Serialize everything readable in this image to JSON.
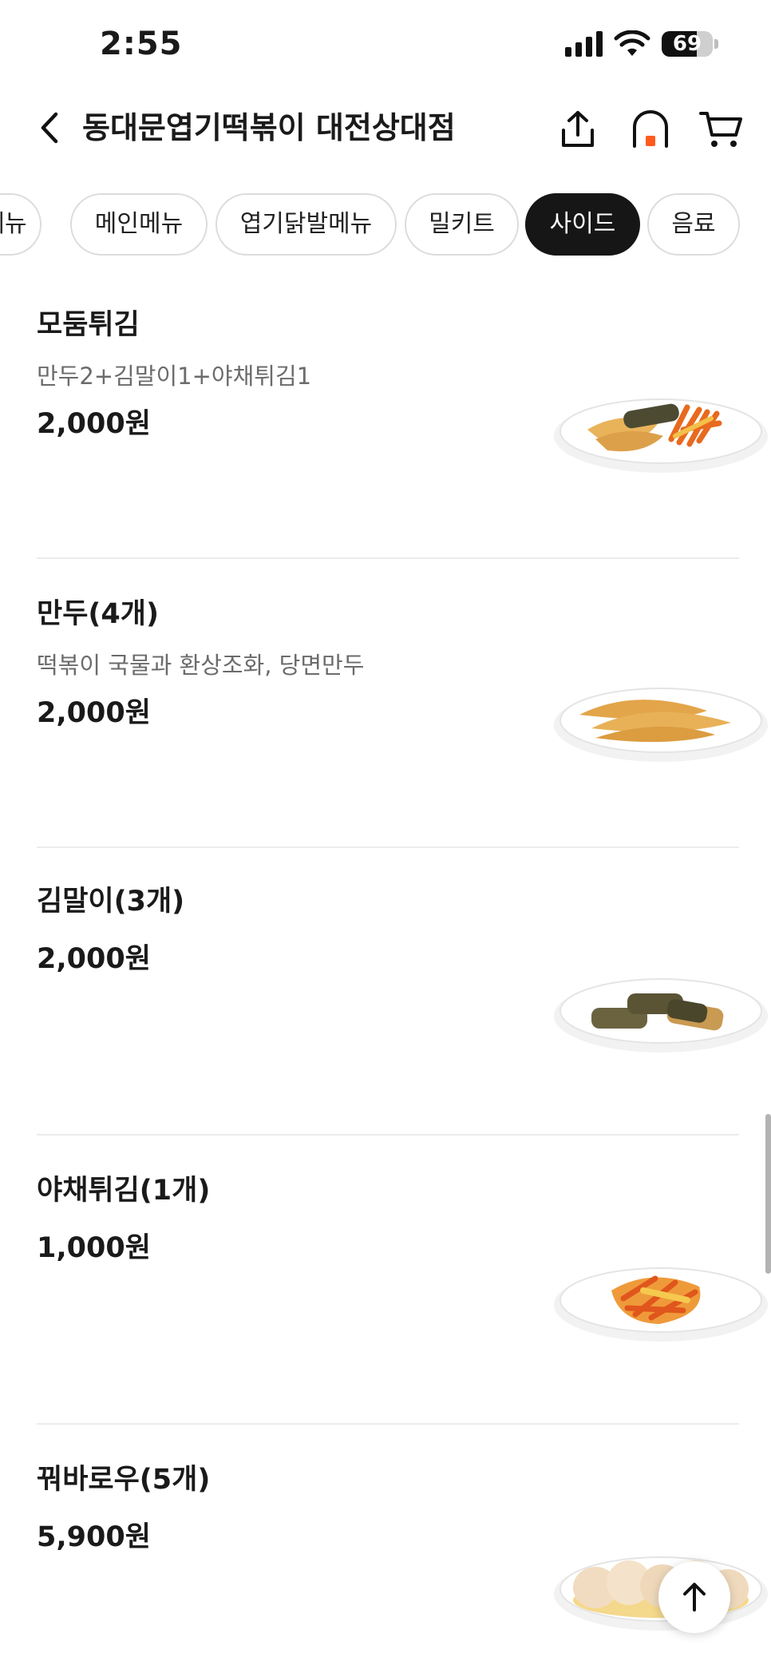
{
  "status_bar": {
    "time": "2:55",
    "battery": "69",
    "battery_level": 0.69
  },
  "header": {
    "title": "동대문엽기떡볶이 대전상대점",
    "icons": [
      "back-icon",
      "share-icon",
      "home-icon",
      "cart-icon"
    ]
  },
  "categories": [
    {
      "label": "메뉴",
      "active": false
    },
    {
      "label": "메인메뉴",
      "active": false
    },
    {
      "label": "엽기닭발메뉴",
      "active": false
    },
    {
      "label": "밀키트",
      "active": false
    },
    {
      "label": "사이드",
      "active": true
    },
    {
      "label": "음료",
      "active": false
    }
  ],
  "menu": [
    {
      "name": "모둠튀김",
      "description": "만두2+김말이1+야채튀김1",
      "price": "2,000원"
    },
    {
      "name": "만두(4개)",
      "description": "떡볶이 국물과 환상조화, 당면만두",
      "price": "2,000원"
    },
    {
      "name": "김말이(3개)",
      "description": "",
      "price": "2,000원"
    },
    {
      "name": "야채튀김(1개)",
      "description": "",
      "price": "1,000원"
    },
    {
      "name": "꿔바로우(5개)",
      "description": "",
      "price": "5,900원"
    }
  ],
  "colors": {
    "accent": "#ff5a1f",
    "active_chip": "#161616"
  }
}
